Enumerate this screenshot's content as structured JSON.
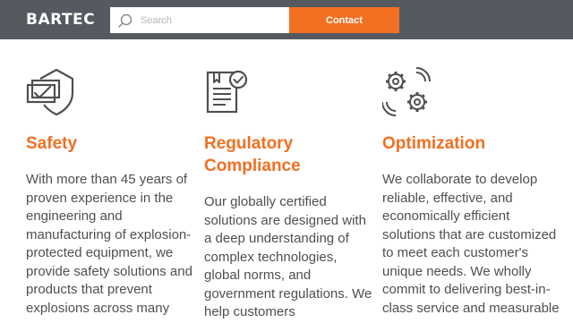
{
  "header": {
    "logo_text": "BARTEC",
    "search": {
      "placeholder": "Search",
      "value": ""
    },
    "contact_label": "Contact"
  },
  "features": [
    {
      "icon": "shield-check-icon",
      "title": "Safety",
      "description": "With more than 45 years of proven experience in the engineering and manufacturing of explosion-protected equipment, we provide safety solutions and products that prevent explosions across many"
    },
    {
      "icon": "certificate-icon",
      "title_line1": "Regulatory",
      "title_line2": "Compliance",
      "description": "Our globally certified solutions are designed with a deep understanding of complex technologies, global norms, and government regulations. We help customers"
    },
    {
      "icon": "gears-signal-icon",
      "title": "Optimization",
      "description": "We collaborate to develop reliable, effective, and economically efficient solutions that are customized to meet each customer's unique needs. We wholly commit to delivering best-in-class service and measurable"
    }
  ],
  "colors": {
    "header_bg": "#555a60",
    "accent": "#f36f21",
    "body_text": "#4d4f52",
    "icon_stroke": "#4d4f52"
  }
}
